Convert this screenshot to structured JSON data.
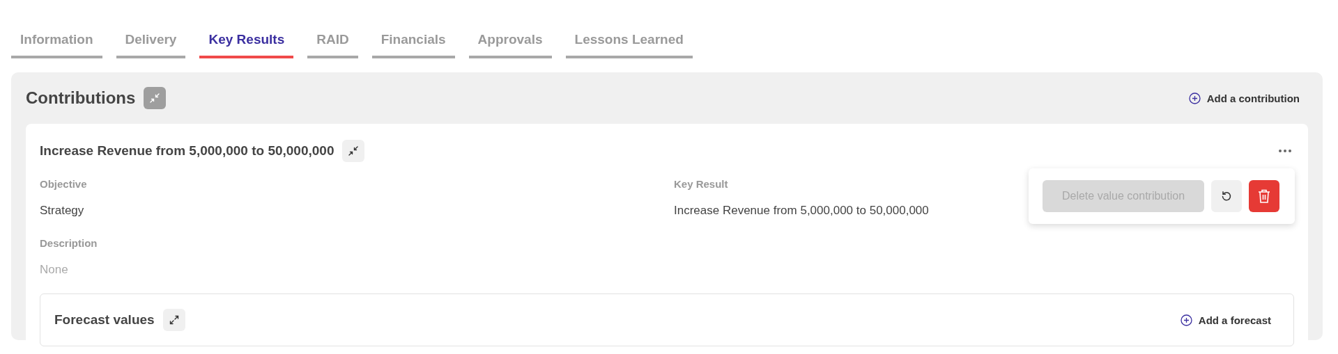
{
  "tabs": [
    {
      "label": "Information",
      "selected": false
    },
    {
      "label": "Delivery",
      "selected": false
    },
    {
      "label": "Key Results",
      "selected": true
    },
    {
      "label": "RAID",
      "selected": false
    },
    {
      "label": "Financials",
      "selected": false
    },
    {
      "label": "Approvals",
      "selected": false
    },
    {
      "label": "Lessons Learned",
      "selected": false
    }
  ],
  "contributions": {
    "title": "Contributions",
    "add_label": "Add a contribution",
    "card": {
      "title": "Increase Revenue from 5,000,000 to 50,000,000",
      "fields": [
        {
          "label": "Objective",
          "value": "Strategy",
          "empty": false
        },
        {
          "label": "Key Result",
          "value": "Increase Revenue from 5,000,000 to 50,000,000",
          "empty": false
        },
        {
          "label": "Description",
          "value": "None",
          "empty": true
        }
      ],
      "menu": {
        "delete_label": "Delete value contribution",
        "delete_disabled": true
      },
      "forecast": {
        "title": "Forecast values",
        "add_label": "Add a forecast"
      }
    }
  }
}
